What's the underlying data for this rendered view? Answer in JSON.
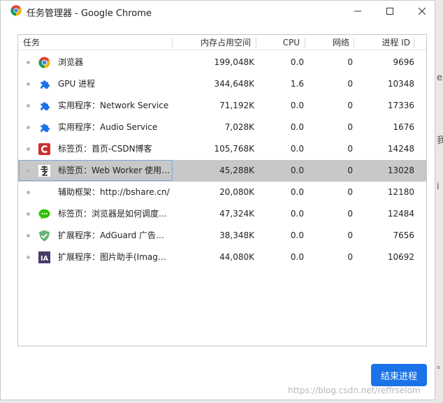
{
  "window": {
    "title": "任务管理器 - Google Chrome",
    "icon": "chrome-icon",
    "controls": {
      "minimize": "minimize-icon",
      "maximize": "maximize-icon",
      "close": "close-icon"
    }
  },
  "table": {
    "headers": {
      "task": "任务",
      "memory": "内存占用空间",
      "cpu": "CPU",
      "network": "网络",
      "pid": "进程 ID"
    },
    "rows": [
      {
        "icon": "chrome-icon",
        "name": "浏览器",
        "memory": "199,048K",
        "cpu": "0.0",
        "network": "0",
        "pid": "9696",
        "selected": false
      },
      {
        "icon": "puzzle-icon",
        "name": "GPU 进程",
        "memory": "344,648K",
        "cpu": "1.6",
        "network": "0",
        "pid": "10348",
        "selected": false
      },
      {
        "icon": "puzzle-icon",
        "name": "实用程序：Network Service",
        "memory": "71,192K",
        "cpu": "0.0",
        "network": "0",
        "pid": "17336",
        "selected": false
      },
      {
        "icon": "puzzle-icon",
        "name": "实用程序：Audio Service",
        "memory": "7,028K",
        "cpu": "0.0",
        "network": "0",
        "pid": "1676",
        "selected": false
      },
      {
        "icon": "csdn-icon",
        "name": "标签页：首页-CSDN博客",
        "memory": "105,768K",
        "cpu": "0.0",
        "network": "0",
        "pid": "14248",
        "selected": false
      },
      {
        "icon": "calligraphy-icon",
        "name": "标签页：Web Worker 使用…",
        "memory": "45,288K",
        "cpu": "0.0",
        "network": "0",
        "pid": "13028",
        "selected": true
      },
      {
        "icon": "",
        "name": "辅助框架：http://bshare.cn/",
        "memory": "20,080K",
        "cpu": "0.0",
        "network": "0",
        "pid": "12180",
        "selected": false
      },
      {
        "icon": "wechat-icon",
        "name": "标签页：浏览器是如何调度…",
        "memory": "47,324K",
        "cpu": "0.0",
        "network": "0",
        "pid": "12484",
        "selected": false
      },
      {
        "icon": "adguard-icon",
        "name": "扩展程序：AdGuard 广告拦…",
        "memory": "38,348K",
        "cpu": "0.0",
        "network": "0",
        "pid": "7656",
        "selected": false
      },
      {
        "icon": "ia-icon",
        "name": "扩展程序：图片助手(Image…",
        "memory": "44,080K",
        "cpu": "0.0",
        "network": "0",
        "pid": "10692",
        "selected": false
      }
    ]
  },
  "actions": {
    "end_process": "结束进程"
  },
  "watermark": "https://blog.csdn.net/reffrselom",
  "background_fragments": [
    "es",
    "我",
    "i",
    "。"
  ],
  "colors": {
    "accent": "#1a73e8",
    "selected_row": "#c8c8c8",
    "puzzle": "#1a73e8",
    "csdn": "#c9302c",
    "wechat": "#2dc100",
    "adguard": "#66b574",
    "ia": "#4a3a6b"
  }
}
